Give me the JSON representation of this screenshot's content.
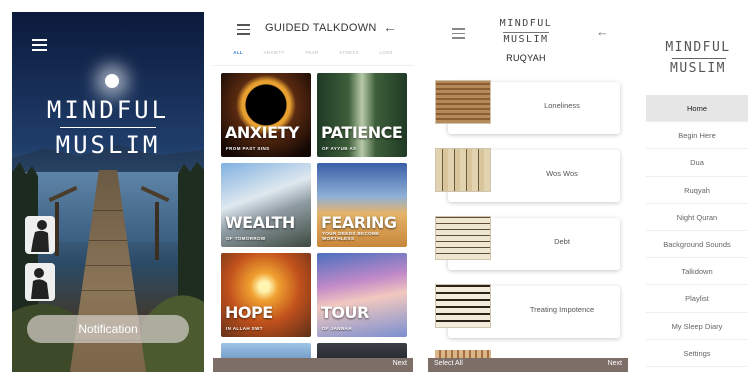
{
  "home": {
    "title_line1": "MINDFUL",
    "title_line2": "MUSLIM",
    "notification_button": "Notification"
  },
  "talkdown": {
    "header_title": "GUIDED TALKDOWN",
    "tabs": [
      "ALL",
      "ANXIETY",
      "FEAR",
      "STRESS",
      "LOSS"
    ],
    "tiles": [
      {
        "title": "ANXIETY",
        "subtitle": "FROM PAST SINS"
      },
      {
        "title": "PATIENCE",
        "subtitle": "OF AYYUB AS"
      },
      {
        "title": "WEALTH",
        "subtitle": "OF TOMORROW"
      },
      {
        "title": "FEARING",
        "subtitle": "YOUR DEEDS BECOME WORTHLESS"
      },
      {
        "title": "HOPE",
        "subtitle": "IN ALLAH SWT"
      },
      {
        "title": "TOUR",
        "subtitle": "OF JANNAH"
      }
    ],
    "next_label": "Next"
  },
  "ruqyah": {
    "logo_line1": "MINDFUL",
    "logo_line2": "MUSLIM",
    "subtitle": "RUQYAH",
    "items": [
      "Loneliness",
      "Wos Wos",
      "Debt",
      "Treating Impotence"
    ],
    "select_all_label": "Select All",
    "next_label": "Next"
  },
  "drawer": {
    "logo_line1": "MINDFUL",
    "logo_line2": "MUSLIM",
    "items": [
      "Home",
      "Begin Here",
      "Dua",
      "Ruqyah",
      "Night Quran",
      "Background Sounds",
      "Talkdown",
      "Playlist",
      "My Sleep Diary",
      "Settings"
    ],
    "active_item": "Home"
  }
}
